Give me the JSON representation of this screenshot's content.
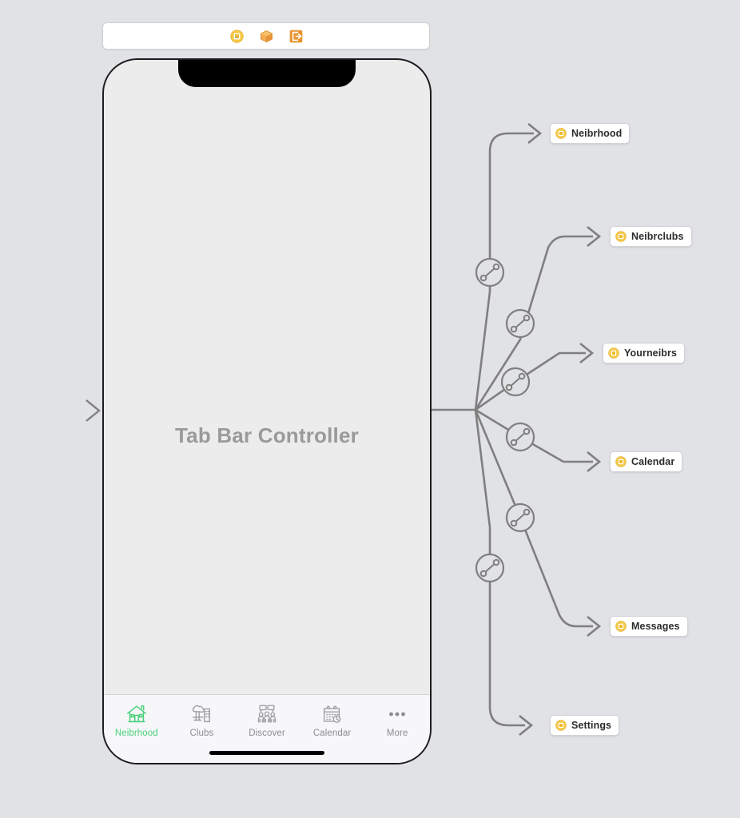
{
  "scene_toolbar": {
    "icons": [
      {
        "name": "view-controller-icon",
        "title": "View Controller"
      },
      {
        "name": "first-responder-icon",
        "title": "First Responder"
      },
      {
        "name": "exit-segue-icon",
        "title": "Exit"
      }
    ]
  },
  "device": {
    "canvas_title": "Tab Bar Controller",
    "tabbar": {
      "items": [
        {
          "icon": "house-icon",
          "label": "Neibrhood",
          "selected": true
        },
        {
          "icon": "clubs-icon",
          "label": "Clubs",
          "selected": false
        },
        {
          "icon": "discover-people-icon",
          "label": "Discover",
          "selected": false
        },
        {
          "icon": "calendar-clock-icon",
          "label": "Calendar",
          "selected": false
        },
        {
          "icon": "more-ellipsis-icon",
          "label": "More",
          "selected": false
        }
      ]
    }
  },
  "relationships": {
    "segue_icon": "relationship-segue-icon",
    "destinations": [
      {
        "label": "Neibrhood",
        "icon": "view-controller-icon"
      },
      {
        "label": "Neibrclubs",
        "icon": "view-controller-icon"
      },
      {
        "label": "Yourneibrs",
        "icon": "view-controller-icon"
      },
      {
        "label": "Calendar",
        "icon": "view-controller-icon"
      },
      {
        "label": "Messages",
        "icon": "view-controller-icon"
      },
      {
        "label": "Settings",
        "icon": "view-controller-icon"
      }
    ]
  },
  "colors": {
    "background": "#e1e2e5",
    "device_screen": "#ececec",
    "selected_tab": "#4cd07d",
    "unselected_tab": "#8d8d92",
    "connection_line": "#7f7f7f",
    "scene_icon_yellow": "#f5c33b",
    "exit_icon_orange": "#e8932e"
  }
}
